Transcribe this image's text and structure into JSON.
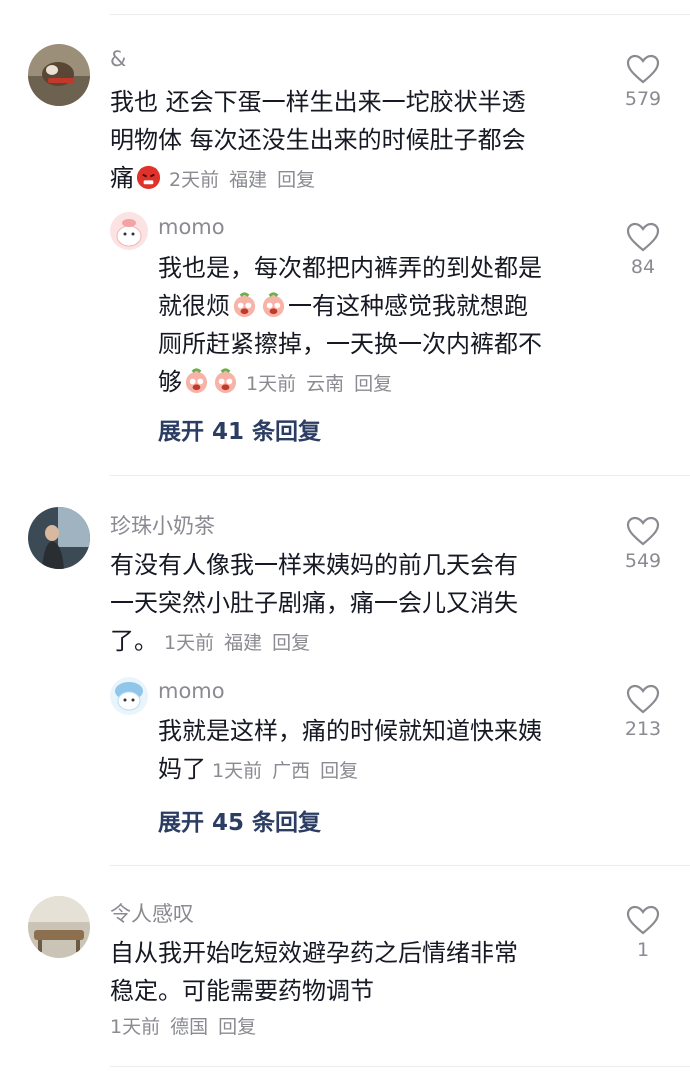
{
  "comments": [
    {
      "author": "&",
      "lines": [
        "我也 还会下蛋一样生出来一坨胶状半透",
        "明物体 每次还没生出来的时候肚子都会",
        "痛"
      ],
      "emoji": "angry-red-face",
      "time": "2天前",
      "location": "福建",
      "reply_label": "回复",
      "likes": "579",
      "reply": {
        "author": "momo",
        "lines": [
          "我也是，每次都把内裤弄的到处都是",
          "就很烦",
          "一有这种感觉我就想跑",
          "厕所赶紧擦掉，一天换一次内裤都不",
          "够"
        ],
        "emoji": "crying-peach-face",
        "time": "1天前",
        "location": "云南",
        "reply_label": "回复",
        "likes": "84"
      },
      "expand_label": "展开 41 条回复"
    },
    {
      "author": "珍珠小奶茶",
      "lines": [
        "有没有人像我一样来姨妈的前几天会有",
        "一天突然小肚子剧痛，痛一会儿又消失",
        "了。"
      ],
      "time": "1天前",
      "location": "福建",
      "reply_label": "回复",
      "likes": "549",
      "reply": {
        "author": "momo",
        "lines": [
          "我就是这样，痛的时候就知道快来姨",
          "妈了"
        ],
        "time": "1天前",
        "location": "广西",
        "reply_label": "回复",
        "likes": "213"
      },
      "expand_label": "展开 45 条回复"
    },
    {
      "author": "令人感叹",
      "lines": [
        "自从我开始吃短效避孕药之后情绪非常",
        "稳定。可能需要药物调节"
      ],
      "time": "1天前",
      "location": "德国",
      "reply_label": "回复",
      "likes": "1"
    }
  ],
  "colors": {
    "text": "#161823",
    "meta": "#8a8b91",
    "expand": "#2b3d63",
    "divider": "#ececec"
  }
}
